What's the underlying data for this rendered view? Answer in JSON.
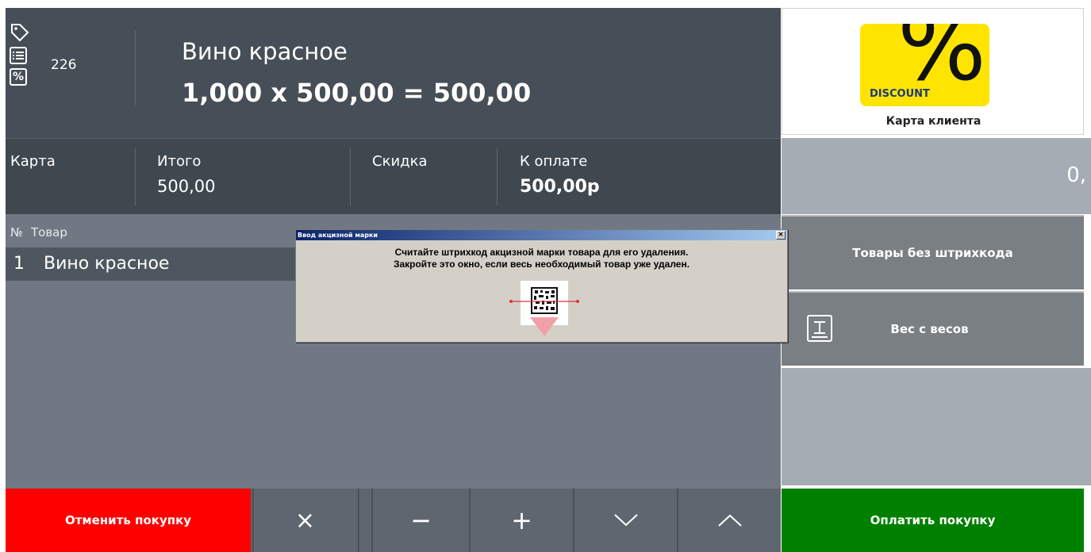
{
  "header": {
    "receipt_number": "226",
    "product_name": "Вино красное",
    "calculation": "1,000 х 500,00 = 500,00",
    "icons": [
      "tag-icon",
      "list-icon",
      "percent-icon"
    ]
  },
  "totals": {
    "card_label": "Карта",
    "total_label": "Итого",
    "total_value": "500,00",
    "discount_label": "Скидка",
    "to_pay_label": "К оплате",
    "to_pay_value": "500,00р"
  },
  "list": {
    "col_num": "№",
    "col_item": "Товар",
    "rows": [
      {
        "num": "1",
        "name": "Вино красное"
      }
    ]
  },
  "toolbar": {
    "cancel_label": "Отменить покупку",
    "delete_icon": "×",
    "minus_icon": "−",
    "plus_icon": "+",
    "down_icon": "chevron-down",
    "up_icon": "chevron-up"
  },
  "right": {
    "discount_badge": "DISCOUNT",
    "discount_symbol": "%",
    "card_label": "Карта клиента",
    "amount": "0,",
    "no_barcode_label": "Товары без штрихкода",
    "scale_label": "Вес с весов",
    "pay_label": "Оплатить покупку"
  },
  "dialog": {
    "title": "Ввод акцизной марки",
    "message_line1": "Считайте штрихкод акцизной марки товара для его удаления.",
    "message_line2": "Закройте это окно, если весь необходимый товар уже удален.",
    "close_symbol": "×"
  },
  "colors": {
    "cancel": "#ff0000",
    "pay": "#008000",
    "header": "#464f57",
    "discount": "#ffe400"
  }
}
